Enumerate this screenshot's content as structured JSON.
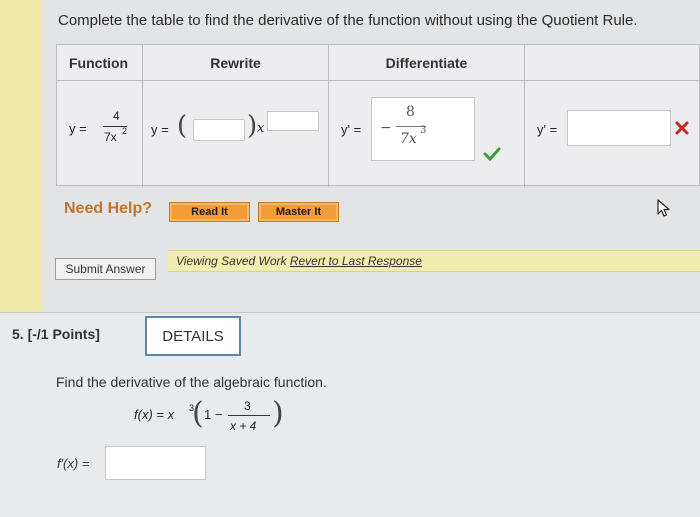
{
  "instruction": "Complete the table to find the derivative of the function without using the Quotient Rule.",
  "table": {
    "headers": {
      "function": "Function",
      "rewrite": "Rewrite",
      "differentiate": "Differentiate"
    },
    "function_cell": {
      "lhs": "y =",
      "num": "4",
      "den": "7x",
      "den_exp": "2"
    },
    "rewrite_cell": {
      "lhs": "y =",
      "paren_open": "(",
      "paren_close": ")",
      "var": "x"
    },
    "diff_cell": {
      "lhs": "y' =",
      "sign": "−",
      "num": "8",
      "den": "7x",
      "den_exp": "3"
    },
    "final_cell": {
      "lhs": "y' ="
    },
    "status": {
      "correct_icon": "checkmark-icon",
      "incorrect_icon": "x-icon",
      "correct_color": "#3a9e3a",
      "incorrect_color": "#c62828"
    }
  },
  "help": {
    "label": "Need Help?",
    "read_it": "Read It",
    "master_it": "Master It",
    "button_color": "#f29c38"
  },
  "submit": {
    "label": "Submit Answer",
    "banner_text": "Viewing Saved Work",
    "banner_link": "Revert to Last Response"
  },
  "question": {
    "number_points": "5.  [-/1 Points]",
    "details": "DETAILS",
    "prompt": "Find the derivative of the algebraic function.",
    "formula": {
      "f": "f(x) = x",
      "exp": "3",
      "open": "(",
      "one_minus": "1 −",
      "num": "3",
      "den": "x + 4",
      "close": ")"
    },
    "answer_label": "f′(x) ="
  },
  "cursor_icon": "mouse-cursor-icon"
}
